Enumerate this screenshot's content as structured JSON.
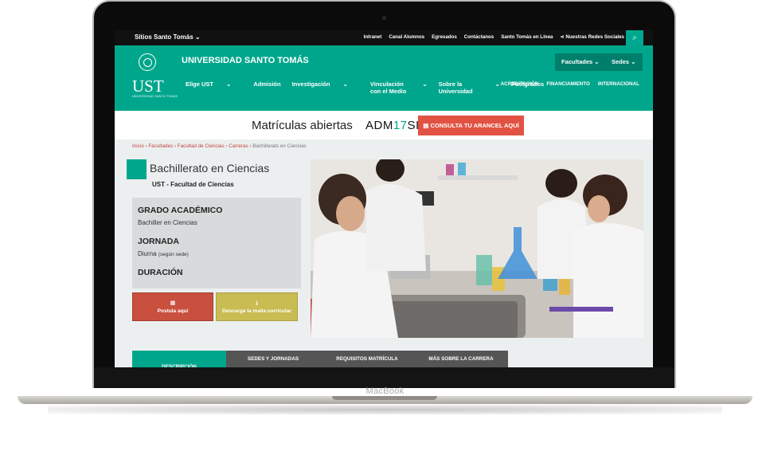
{
  "device": {
    "brand": "MacBook"
  },
  "topbar": {
    "sites_label": "Sitios Santo Tomás",
    "links": [
      "Intranet",
      "Canal Alumnos",
      "Egresados",
      "Contáctanos",
      "Santo Tomás en Línea"
    ],
    "social": "Nuestras Redes Sociales"
  },
  "header": {
    "logo_text": "UST",
    "logo_sub": "UNIVERSIDAD SANTO TOMÁS",
    "university": "UNIVERSIDAD SANTO TOMÁS",
    "facultades": "Facultades",
    "sedes": "Sedes",
    "menu": [
      {
        "line1": "Elige UST",
        "line2": ""
      },
      {
        "line1": "Admisión",
        "line2": ""
      },
      {
        "line1": "Investigación",
        "line2": ""
      },
      {
        "line1": "Vinculación",
        "line2": "con el Medio"
      },
      {
        "line1": "Sobre la",
        "line2": "Universidad"
      },
      {
        "line1": "Postgrados",
        "line2": ""
      }
    ],
    "menu_right": [
      "ACREDITACIÓN",
      "FINANCIAMIENTO",
      "INTERNACIONAL"
    ]
  },
  "banner": {
    "text": "Matrículas abiertas",
    "admision_prefix": "ADM",
    "admision_digits": "17",
    "admision_suffix": "SIÓN",
    "cta": "CONSULTA TU ARANCEL AQUÍ"
  },
  "breadcrumb": {
    "items": [
      "Inicio",
      "Facultades",
      "Facultad de Ciencias",
      "Carreras"
    ],
    "current": "Bachillerato en Ciencias"
  },
  "career": {
    "title": "Bachillerato en Ciencias",
    "faculty": "UST - Facultad de Ciencias"
  },
  "info": {
    "grado_label": "GRADO ACADÉMICO",
    "grado_value": "Bachiller en Ciencias",
    "jornada_label": "JORNADA",
    "jornada_value": "Diurna",
    "jornada_note": "(según sede)",
    "duracion_label": "DURACIÓN"
  },
  "actions": {
    "postula": "Postula aquí",
    "malla": "Descarga la malla curricular"
  },
  "tabs": [
    "DESCRIPCIÓN",
    "SEDES Y JORNADAS",
    "REQUISITOS MATRÍCULA",
    "MÁS SOBRE LA CARRERA"
  ],
  "colors": {
    "primary": "#00a68c",
    "accent": "#e25243",
    "malla": "#c8bc52"
  }
}
